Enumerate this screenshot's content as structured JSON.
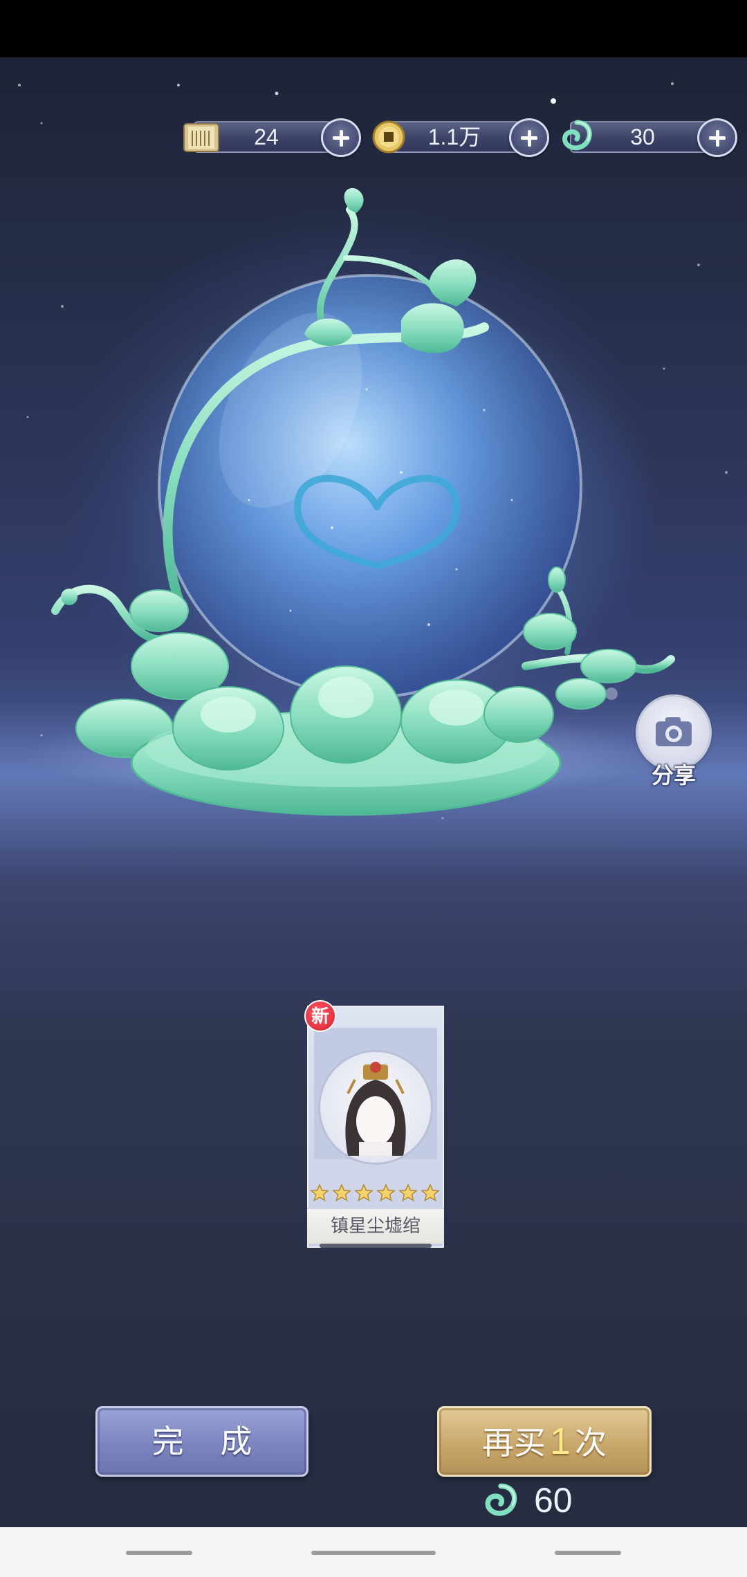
{
  "currencies": [
    {
      "id": "scroll",
      "value": "24",
      "icon": "scroll-icon"
    },
    {
      "id": "coin",
      "value": "1.1万",
      "icon": "coin-icon"
    },
    {
      "id": "jade",
      "value": "30",
      "icon": "jade-swirl-icon"
    }
  ],
  "share": {
    "label": "分享",
    "icon": "camera-icon"
  },
  "item": {
    "badge": "新",
    "name": "镇星尘墟绾",
    "stars": 6
  },
  "actions": {
    "done_label": "完 成",
    "buy_again_prefix": "再买",
    "buy_again_count": "1",
    "buy_again_suffix": "次",
    "cost": "60",
    "cost_icon": "jade-swirl-icon"
  },
  "colors": {
    "accent_done": "#7c85bf",
    "accent_buy": "#c9a86b",
    "jade": "#7fe0c0"
  }
}
